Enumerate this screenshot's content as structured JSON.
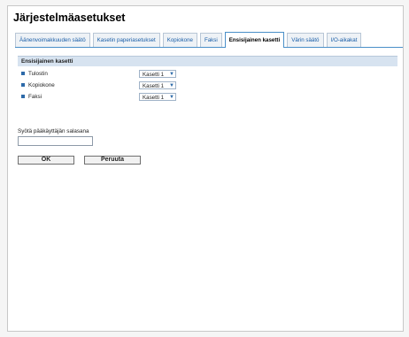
{
  "page_title": "Järjestelmäasetukset",
  "tabs": [
    {
      "label": "Äänenvoimakkuuden säätö",
      "active": false
    },
    {
      "label": "Kasetin paperiasetukset",
      "active": false
    },
    {
      "label": "Kopiokone",
      "active": false
    },
    {
      "label": "Faksi",
      "active": false
    },
    {
      "label": "Ensisijainen kasetti",
      "active": true
    },
    {
      "label": "Värin säätö",
      "active": false
    },
    {
      "label": "I/O-aikakat",
      "active": false
    }
  ],
  "section": {
    "title": "Ensisijainen kasetti",
    "rows": [
      {
        "label": "Tulostin",
        "value": "Kasetti 1"
      },
      {
        "label": "Kopiokone",
        "value": "Kasetti 1"
      },
      {
        "label": "Faksi",
        "value": "Kasetti 1"
      }
    ]
  },
  "password": {
    "label": "Syötä pääkäyttäjän salasana",
    "value": ""
  },
  "buttons": {
    "ok": "OK",
    "cancel": "Peruuta"
  },
  "icons": {
    "row_bullet": "square-bullet-icon",
    "select_arrow": "chevron-down-icon"
  }
}
